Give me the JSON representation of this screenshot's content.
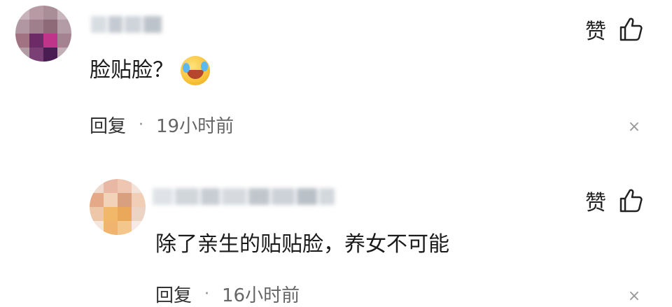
{
  "comments": [
    {
      "content": "脸贴脸？",
      "emoji": "laughing-crying-emoji",
      "like_label": "赞",
      "reply_label": "回复",
      "separator": "·",
      "time": "19小时前",
      "close_icon": "×"
    },
    {
      "content": "除了亲生的贴贴脸，养女不可能",
      "like_label": "赞",
      "reply_label": "回复",
      "separator": "·",
      "time": "16小时前",
      "close_icon": "×"
    }
  ],
  "colors": {
    "text": "#1a1a1a",
    "meta": "#666666",
    "close": "#999999"
  }
}
